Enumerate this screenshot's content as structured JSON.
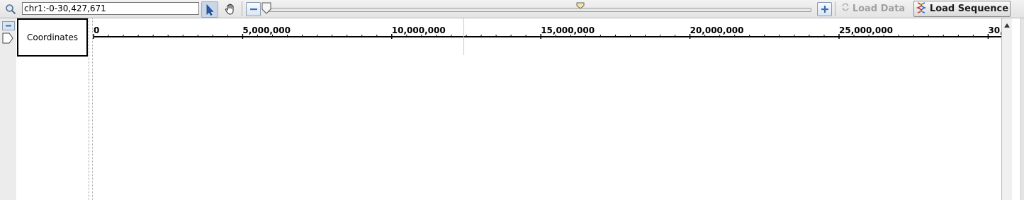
{
  "locus": {
    "value": "chr1:-0-30,427,671"
  },
  "toolbar": {
    "load_data_label": "Load Data",
    "load_sequence_label": "Load Sequence"
  },
  "zoom": {
    "level_fraction": 0.0
  },
  "tracks": [
    {
      "label": "Coordinates"
    }
  ],
  "ruler": {
    "ticks": [
      "0",
      "5,000,000",
      "10,000,000",
      "15,000,000",
      "20,000,000",
      "25,000,000",
      "30,"
    ]
  },
  "colors": {
    "accent": "#3a6fb0",
    "disabled_text": "#a0a0a0"
  }
}
